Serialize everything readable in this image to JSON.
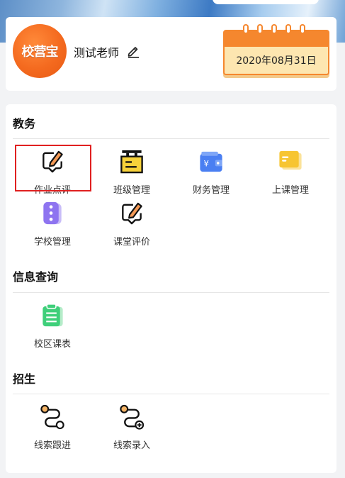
{
  "profile": {
    "logo_text": "校营宝",
    "teacher_name": "测试老师",
    "date": "2020年08月31日"
  },
  "sections": {
    "academic": {
      "title": "教务",
      "items": [
        {
          "label": "作业点评",
          "icon": "pen-note-icon"
        },
        {
          "label": "班级管理",
          "icon": "class-sign-icon"
        },
        {
          "label": "财务管理",
          "icon": "wallet-icon"
        },
        {
          "label": "上课管理",
          "icon": "card-stack-icon"
        },
        {
          "label": "学校管理",
          "icon": "school-list-icon"
        },
        {
          "label": "课堂评价",
          "icon": "pen-note-icon"
        }
      ]
    },
    "info": {
      "title": "信息查询",
      "items": [
        {
          "label": "校区课表",
          "icon": "clipboard-list-icon"
        }
      ]
    },
    "recruit": {
      "title": "招生",
      "items": [
        {
          "label": "线索跟进",
          "icon": "route-icon"
        },
        {
          "label": "线索录入",
          "icon": "route-add-icon"
        }
      ]
    }
  },
  "colors": {
    "accent_orange": "#f5872e",
    "highlight_red": "#e02020",
    "wallet_blue": "#4a7ff2",
    "card_yellow": "#f7c531",
    "school_purple": "#8e74f0",
    "clipboard_green": "#3fcf7a"
  }
}
